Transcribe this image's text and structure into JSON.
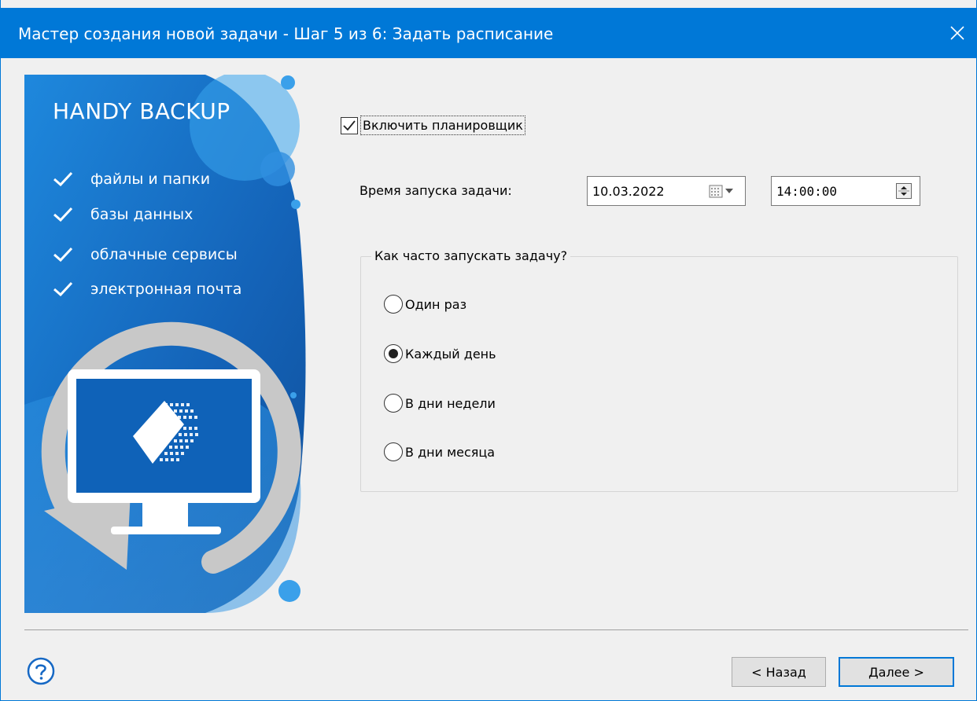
{
  "window": {
    "title": "Мастер создания новой задачи - Шаг 5 из 6: Задать расписание",
    "accent_color": "#0078d7"
  },
  "banner": {
    "brand": "HANDY BACKUP",
    "features": [
      "файлы и папки",
      "базы данных",
      "облачные сервисы",
      "электронная почта"
    ],
    "colors": {
      "dark": "#1558a8",
      "mid": "#1e7ad0",
      "light": "#3aa0ea"
    }
  },
  "scheduler": {
    "enable_label": "Включить планировщик",
    "enabled": true,
    "start_time_label": "Время запуска задачи:",
    "date_value": "10.03.2022",
    "time_value": "14:00:00"
  },
  "frequency": {
    "title": "Как часто запускать задачу?",
    "options": [
      {
        "label": "Один раз",
        "selected": false
      },
      {
        "label": "Каждый день",
        "selected": true
      },
      {
        "label": "В дни недели",
        "selected": false
      },
      {
        "label": "В дни месяца",
        "selected": false
      }
    ]
  },
  "footer": {
    "back_label": "< Назад",
    "next_label": "Далее >"
  }
}
